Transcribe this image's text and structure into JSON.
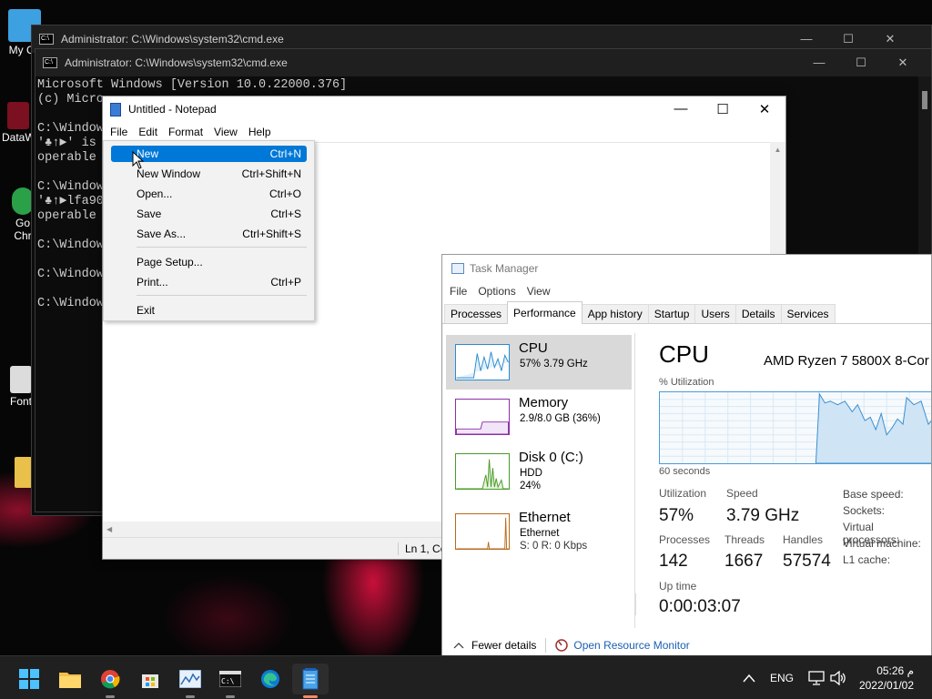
{
  "desktop_icons": [
    {
      "label": "My Co"
    },
    {
      "label": "DataW"
    },
    {
      "label": "Go Chr"
    },
    {
      "label": "Font"
    }
  ],
  "cmd_back": {
    "title": "Administrator: C:\\Windows\\system32\\cmd.exe"
  },
  "cmd_front": {
    "title": "Administrator: C:\\Windows\\system32\\cmd.exe",
    "lines": [
      "Microsoft Windows [Version 10.0.22000.376]",
      "(c) Micro",
      "",
      "C:\\Window",
      "'♣↑►' is",
      "operable",
      "",
      "C:\\Window",
      "'♣↑►lfa90",
      "operable",
      "",
      "C:\\Window",
      "",
      "C:\\Window",
      "",
      "C:\\Window"
    ]
  },
  "notepad": {
    "title": "Untitled - Notepad",
    "menu": [
      "File",
      "Edit",
      "Format",
      "View",
      "Help"
    ],
    "status": "Ln 1, Co"
  },
  "file_menu": {
    "items": [
      {
        "label": "New",
        "shortcut": "Ctrl+N"
      },
      {
        "label": "New Window",
        "shortcut": "Ctrl+Shift+N"
      },
      {
        "label": "Open...",
        "shortcut": "Ctrl+O"
      },
      {
        "label": "Save",
        "shortcut": "Ctrl+S"
      },
      {
        "label": "Save As...",
        "shortcut": "Ctrl+Shift+S"
      },
      {
        "label": "Page Setup...",
        "shortcut": ""
      },
      {
        "label": "Print...",
        "shortcut": "Ctrl+P"
      },
      {
        "label": "Exit",
        "shortcut": ""
      }
    ]
  },
  "task_manager": {
    "title": "Task Manager",
    "menu": [
      "File",
      "Options",
      "View"
    ],
    "tabs": [
      "Processes",
      "Performance",
      "App history",
      "Startup",
      "Users",
      "Details",
      "Services"
    ],
    "active_tab": "Performance",
    "resources": [
      {
        "name": "CPU",
        "line2": "57%  3.79 GHz",
        "line3": "",
        "line4": ""
      },
      {
        "name": "Memory",
        "line2": "2.9/8.0 GB (36%)",
        "line3": "",
        "line4": ""
      },
      {
        "name": "Disk 0 (C:)",
        "line2": "HDD",
        "line3": "24%",
        "line4": ""
      },
      {
        "name": "Ethernet",
        "line2": "Ethernet",
        "line3": "S: 0  R: 0 Kbps",
        "line4": ""
      }
    ],
    "main": {
      "heading": "CPU",
      "cpu_name": "AMD Ryzen 7 5800X 8-Cor",
      "utilization_label": "% Utilization",
      "time_label": "60 seconds",
      "utilization_title": "Utilization",
      "utilization_value": "57%",
      "speed_title": "Speed",
      "speed_value": "3.79 GHz",
      "processes_title": "Processes",
      "processes_value": "142",
      "threads_title": "Threads",
      "threads_value": "1667",
      "handles_title": "Handles",
      "handles_value": "57574",
      "uptime_title": "Up time",
      "uptime_value": "0:00:03:07",
      "right_labels": [
        "Base speed:",
        "Sockets:",
        "Virtual processors:",
        "Virtual machine:",
        "L1 cache:"
      ]
    },
    "fewer_details": "Fewer details",
    "open_resource_monitor": "Open Resource Monitor"
  },
  "taskbar": {
    "apps": [
      "start-icon",
      "file-explorer-icon",
      "chrome-icon",
      "store-icon",
      "task-manager-icon",
      "terminal-icon",
      "edge-icon",
      "notepad-icon"
    ],
    "language": "ENG",
    "time": "05:26 م",
    "date": "2022/01/02"
  }
}
